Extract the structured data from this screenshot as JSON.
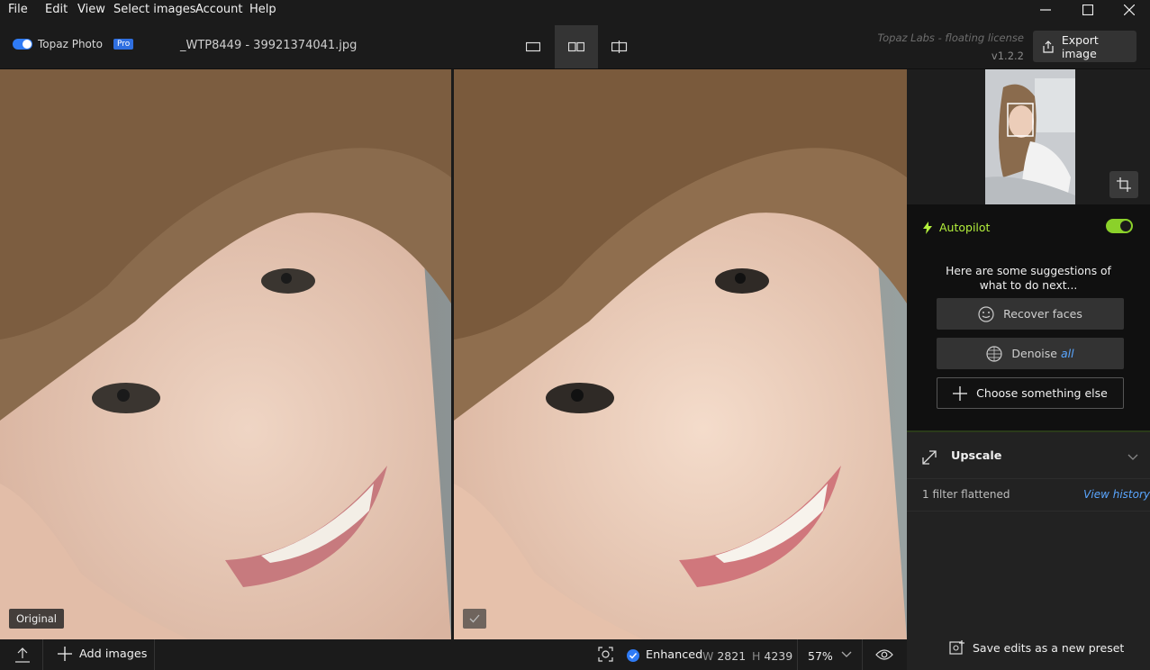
{
  "menu": {
    "items": [
      "File",
      "Edit",
      "View",
      "Select images",
      "Account",
      "Help"
    ]
  },
  "app": {
    "logo_text": "Topaz Photo",
    "badge": "Pro",
    "filename": "_WTP8449 - 39921374041.jpg",
    "license": "Topaz Labs - floating license",
    "version": "v1.2.2",
    "export_label": "Export image"
  },
  "preview": {
    "original_label": "Original"
  },
  "panel": {
    "autopilot_label": "Autopilot",
    "autopilot_on": true,
    "suggestion_text": "Here are some suggestions of what to do next...",
    "recover_faces": "Recover faces",
    "denoise": "Denoise",
    "denoise_scope": "all",
    "choose_else": "Choose something else",
    "upscale_label": "Upscale",
    "filter_status": "1 filter flattened",
    "view_history": "View history",
    "save_preset": "Save edits as a new preset"
  },
  "bottom": {
    "add_images": "Add images",
    "enhanced_label": "Enhanced",
    "width_label": "W",
    "width_value": "2821",
    "height_label": "H",
    "height_value": "4239",
    "zoom": "57%"
  },
  "colors": {
    "accent_blue": "#2f7bf5",
    "autopilot_green": "#b3f03c",
    "link_blue": "#5aa6ff"
  }
}
